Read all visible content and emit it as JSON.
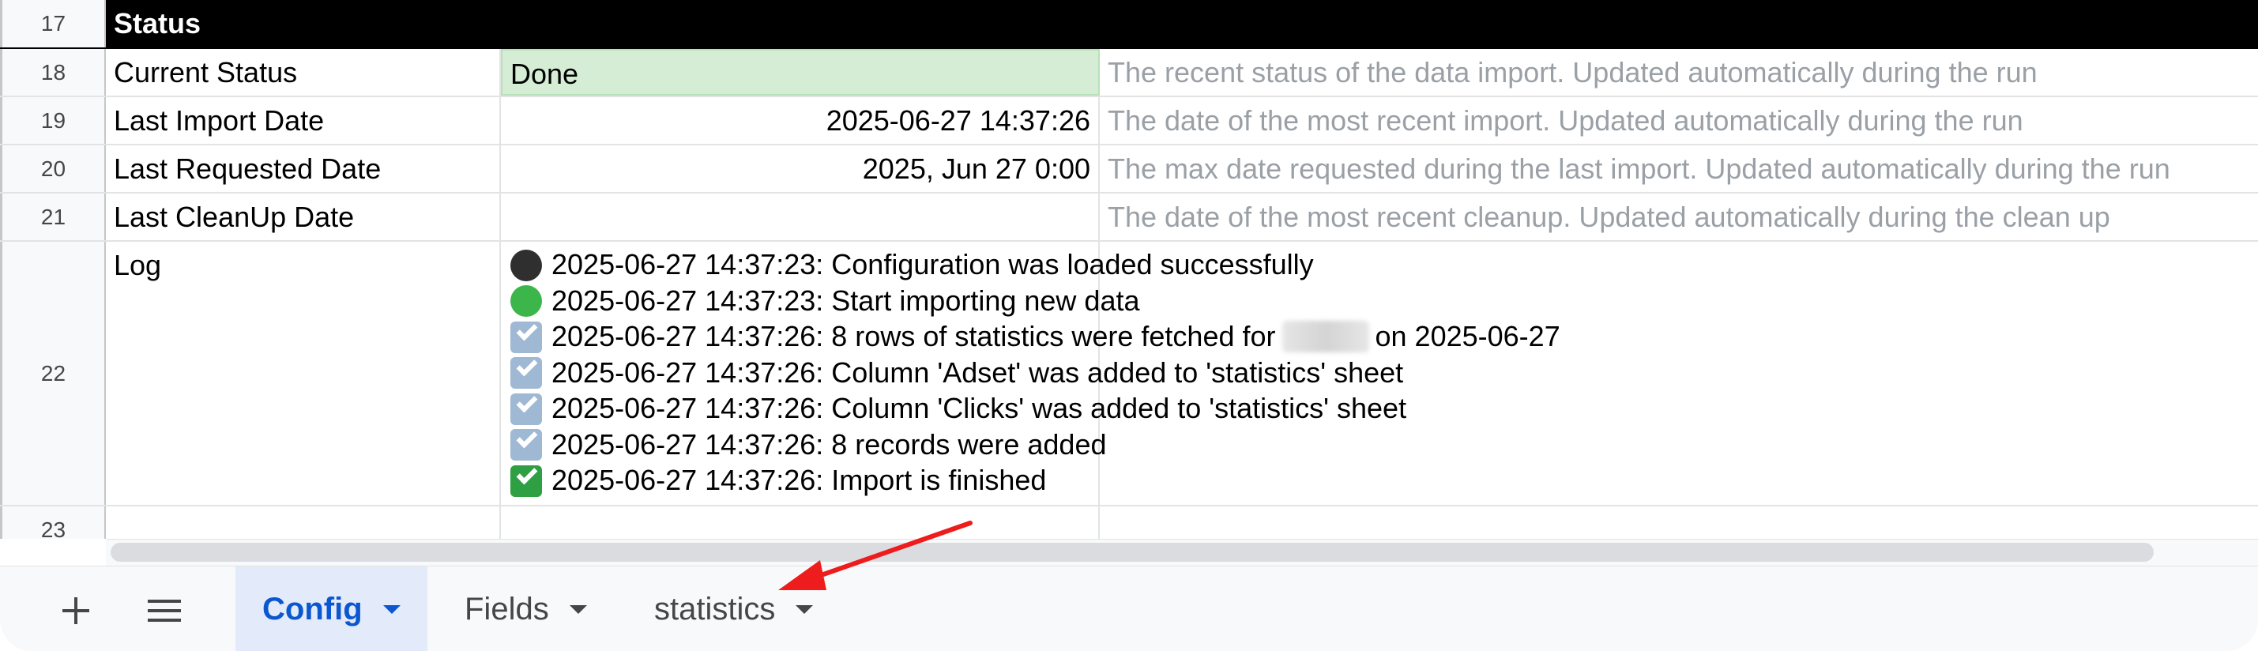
{
  "rows": {
    "r17": {
      "num": "17",
      "title": "Status"
    },
    "r18": {
      "num": "18",
      "label": "Current Status",
      "value": "Done",
      "desc": "The recent status of the data import. Updated automatically during the run"
    },
    "r19": {
      "num": "19",
      "label": "Last Import Date",
      "value": "2025-06-27 14:37:26",
      "desc": "The date of the most recent import. Updated automatically during the run"
    },
    "r20": {
      "num": "20",
      "label": "Last Requested Date",
      "value": "2025, Jun 27 0:00",
      "desc": "The max date requested during the last import. Updated automatically during the run"
    },
    "r21": {
      "num": "21",
      "label": "Last CleanUp Date",
      "value": "",
      "desc": "The date of the most recent cleanup. Updated automatically during the clean up"
    },
    "r22": {
      "num": "22",
      "label": "Log",
      "log": [
        {
          "icon": "black-circle-icon",
          "text": "2025-06-27 14:37:23: Configuration was loaded successfully"
        },
        {
          "icon": "green-circle-icon",
          "text": "2025-06-27 14:37:23: Start importing new data"
        },
        {
          "icon": "ballot-box-check-icon",
          "text_before": "2025-06-27 14:37:26: 8 rows of statistics were fetched for",
          "text_after": "on 2025-06-27"
        },
        {
          "icon": "ballot-box-check-icon",
          "text": "2025-06-27 14:37:26: Column 'Adset' was added to 'statistics' sheet"
        },
        {
          "icon": "ballot-box-check-icon",
          "text": "2025-06-27 14:37:26: Column 'Clicks' was added to 'statistics' sheet"
        },
        {
          "icon": "ballot-box-check-icon",
          "text": "2025-06-27 14:37:26: 8 records were added"
        },
        {
          "icon": "green-check-mark-icon",
          "text": "2025-06-27 14:37:26: Import is finished"
        }
      ]
    },
    "r23": {
      "num": "23"
    }
  },
  "tabbar": {
    "add_icon": "plus-icon",
    "menu_icon": "hamburger-menu-icon",
    "tabs": [
      {
        "label": "Config",
        "active": true
      },
      {
        "label": "Fields",
        "active": false
      },
      {
        "label": "statistics",
        "active": false
      }
    ]
  },
  "colors": {
    "status_header_bg": "#000000",
    "done_bg": "#d4edd4",
    "description_text": "#9aa0a6",
    "active_tab_bg": "#e3ebfa",
    "active_tab_text": "#0b57d0",
    "annotation_arrow": "#ee1c1c"
  }
}
